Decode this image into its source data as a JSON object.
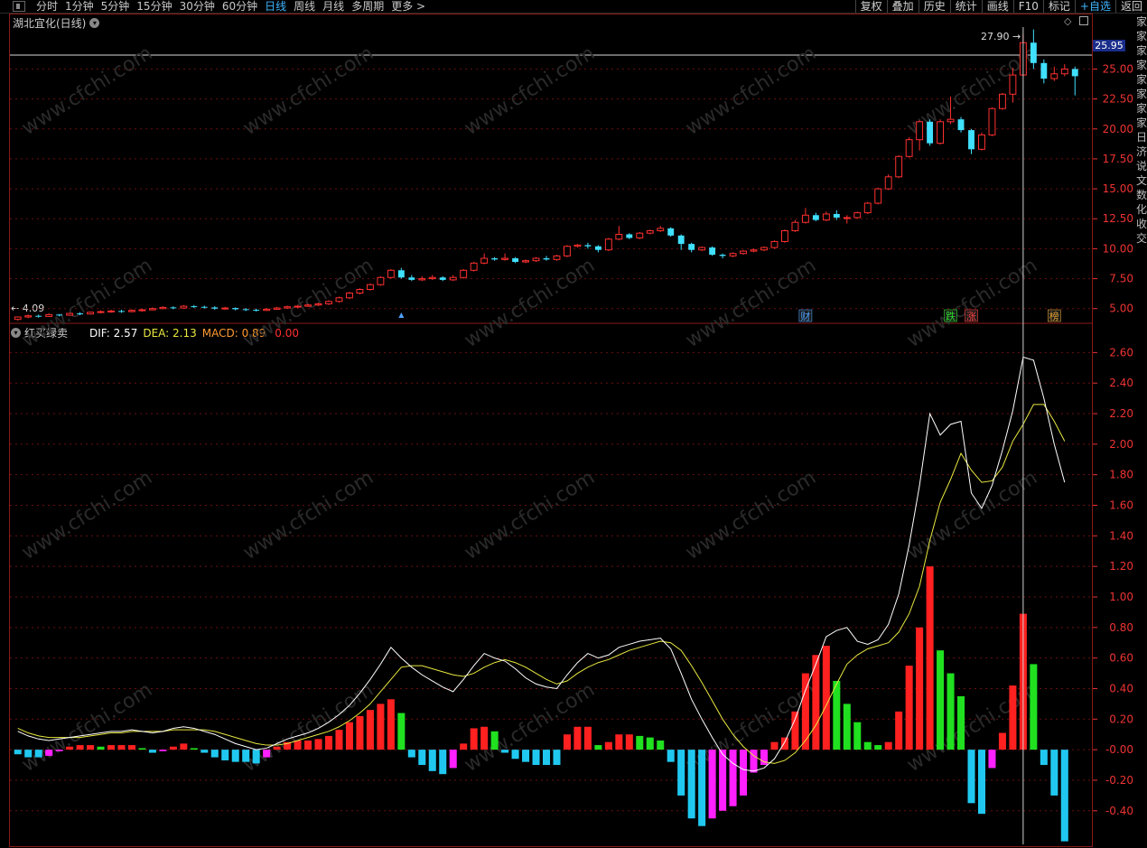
{
  "toolbar": {
    "periods": [
      "分时",
      "1分钟",
      "5分钟",
      "15分钟",
      "30分钟",
      "60分钟",
      "日线",
      "周线",
      "月线",
      "多周期",
      "更多 >"
    ],
    "active_period": "日线",
    "right_buttons": [
      "复权",
      "叠加",
      "历史",
      "统计",
      "画线",
      "F10",
      "标记",
      "+自选",
      "返回"
    ]
  },
  "price_pane": {
    "title": "湖北宜化(日线)",
    "high_label": "27.90",
    "low_label": "4.09",
    "current_price": "25.95",
    "axis_ticks": [
      "25.00",
      "22.50",
      "20.00",
      "17.50",
      "15.00",
      "12.50",
      "10.00",
      "7.50",
      "5.00"
    ],
    "annotations": [
      {
        "text": "财",
        "color": "#4da3ff"
      },
      {
        "text": "跌",
        "color": "#2de02d"
      },
      {
        "text": "涨",
        "color": "#ff4040"
      },
      {
        "text": "榜",
        "color": "#e0a030"
      }
    ]
  },
  "macd_pane": {
    "title": "红买绿卖",
    "dif_label": "DIF: 2.57",
    "dea_label": "DEA: 2.13",
    "macd_label": "MACD: 0.89",
    "extra_label": "0.00",
    "axis_ticks": [
      "2.60",
      "2.40",
      "2.20",
      "2.00",
      "1.80",
      "1.60",
      "1.40",
      "1.20",
      "1.00",
      "0.80",
      "0.60",
      "0.40",
      "0.20",
      "-0.00",
      "-0.20",
      "-0.40"
    ]
  },
  "right_column_chars": [
    "家",
    "家",
    "家",
    "家",
    "家",
    "家",
    "家",
    "家",
    "日",
    "济",
    "说",
    "文",
    "数",
    "化",
    "收",
    "交"
  ],
  "colors": {
    "up": "#ff3030",
    "down": "#40e0ff",
    "dif": "#ffffff",
    "dea": "#e8e840",
    "hist_up": "#ff2020",
    "hist_weak_up": "#20e020",
    "hist_down": "#20c8f0",
    "hist_weak_down": "#ff20ff",
    "grid": "#6a1010"
  },
  "watermark": "www.cfchi.com",
  "chart_data": {
    "type": "candlestick",
    "y_range": [
      4.0,
      28.5
    ],
    "candles": [
      [
        4.1,
        4.3,
        4.0,
        4.35
      ],
      [
        4.3,
        4.4,
        4.2,
        4.5
      ],
      [
        4.4,
        4.35,
        4.25,
        4.5
      ],
      [
        4.35,
        4.5,
        4.3,
        4.6
      ],
      [
        4.5,
        4.45,
        4.35,
        4.55
      ],
      [
        4.45,
        4.6,
        4.4,
        4.65
      ],
      [
        4.6,
        4.55,
        4.45,
        4.7
      ],
      [
        4.55,
        4.7,
        4.5,
        4.75
      ],
      [
        4.7,
        4.75,
        4.6,
        4.85
      ],
      [
        4.75,
        4.8,
        4.65,
        4.9
      ],
      [
        4.8,
        4.75,
        4.65,
        4.9
      ],
      [
        4.75,
        4.85,
        4.7,
        4.95
      ],
      [
        4.85,
        4.9,
        4.75,
        5.0
      ],
      [
        4.9,
        5.0,
        4.85,
        5.1
      ],
      [
        5.0,
        5.1,
        4.95,
        5.2
      ],
      [
        5.1,
        5.05,
        4.95,
        5.2
      ],
      [
        5.05,
        5.2,
        5.0,
        5.3
      ],
      [
        5.2,
        5.15,
        5.05,
        5.3
      ],
      [
        5.15,
        5.1,
        5.0,
        5.25
      ],
      [
        5.1,
        5.0,
        4.9,
        5.2
      ],
      [
        5.0,
        5.05,
        4.9,
        5.15
      ],
      [
        5.05,
        4.95,
        4.85,
        5.1
      ],
      [
        4.95,
        4.9,
        4.8,
        5.05
      ],
      [
        4.9,
        4.85,
        4.75,
        5.0
      ],
      [
        4.85,
        4.95,
        4.8,
        5.05
      ],
      [
        4.95,
        5.05,
        4.9,
        5.15
      ],
      [
        5.05,
        5.15,
        5.0,
        5.25
      ],
      [
        5.15,
        5.2,
        5.05,
        5.3
      ],
      [
        5.2,
        5.3,
        5.15,
        5.4
      ],
      [
        5.3,
        5.4,
        5.2,
        5.5
      ],
      [
        5.4,
        5.6,
        5.3,
        5.7
      ],
      [
        5.6,
        5.9,
        5.5,
        6.0
      ],
      [
        5.9,
        6.3,
        5.8,
        6.4
      ],
      [
        6.3,
        6.6,
        6.2,
        6.7
      ],
      [
        6.6,
        7.0,
        6.5,
        7.1
      ],
      [
        7.0,
        7.6,
        6.9,
        7.7
      ],
      [
        7.6,
        8.2,
        7.5,
        8.3
      ],
      [
        8.2,
        7.6,
        7.5,
        8.4
      ],
      [
        7.6,
        7.4,
        7.3,
        7.8
      ],
      [
        7.4,
        7.5,
        7.3,
        7.7
      ],
      [
        7.5,
        7.6,
        7.4,
        7.8
      ],
      [
        7.6,
        7.4,
        7.3,
        7.7
      ],
      [
        7.4,
        7.6,
        7.3,
        7.8
      ],
      [
        7.6,
        8.2,
        7.5,
        8.3
      ],
      [
        8.2,
        8.8,
        8.1,
        8.9
      ],
      [
        8.8,
        9.2,
        8.7,
        9.6
      ],
      [
        9.2,
        9.1,
        9.0,
        9.3
      ],
      [
        9.1,
        9.2,
        9.0,
        9.6
      ],
      [
        9.2,
        8.9,
        8.8,
        9.3
      ],
      [
        8.9,
        9.0,
        8.8,
        9.1
      ],
      [
        9.0,
        9.2,
        8.9,
        9.3
      ],
      [
        9.2,
        9.1,
        9.0,
        9.4
      ],
      [
        9.1,
        9.4,
        9.0,
        9.5
      ],
      [
        9.4,
        10.2,
        9.3,
        10.3
      ],
      [
        10.2,
        10.3,
        10.1,
        10.4
      ],
      [
        10.3,
        10.2,
        10.0,
        10.5
      ],
      [
        10.2,
        9.9,
        9.7,
        10.3
      ],
      [
        9.9,
        10.8,
        9.8,
        10.9
      ],
      [
        10.8,
        11.2,
        10.7,
        11.9
      ],
      [
        11.2,
        10.9,
        10.8,
        11.3
      ],
      [
        10.9,
        11.3,
        10.8,
        11.4
      ],
      [
        11.3,
        11.5,
        11.2,
        11.6
      ],
      [
        11.5,
        11.7,
        11.4,
        11.9
      ],
      [
        11.7,
        11.1,
        11.0,
        11.8
      ],
      [
        11.1,
        10.4,
        9.9,
        11.2
      ],
      [
        10.4,
        9.9,
        9.7,
        10.5
      ],
      [
        9.9,
        10.1,
        9.8,
        10.2
      ],
      [
        10.1,
        9.5,
        9.4,
        10.2
      ],
      [
        9.5,
        9.4,
        9.2,
        9.6
      ],
      [
        9.4,
        9.6,
        9.3,
        9.7
      ],
      [
        9.6,
        9.8,
        9.5,
        9.9
      ],
      [
        9.8,
        9.9,
        9.7,
        10.0
      ],
      [
        9.9,
        10.1,
        9.8,
        10.2
      ],
      [
        10.1,
        10.6,
        10.0,
        10.7
      ],
      [
        10.6,
        11.5,
        10.5,
        11.6
      ],
      [
        11.5,
        12.2,
        11.4,
        12.4
      ],
      [
        12.2,
        12.8,
        12.1,
        13.4
      ],
      [
        12.8,
        12.4,
        12.3,
        13.0
      ],
      [
        12.4,
        12.9,
        12.3,
        13.1
      ],
      [
        12.9,
        12.6,
        12.4,
        13.2
      ],
      [
        12.6,
        12.6,
        12.1,
        12.8
      ],
      [
        12.6,
        13.0,
        12.5,
        13.1
      ],
      [
        13.0,
        13.8,
        12.9,
        13.9
      ],
      [
        13.8,
        15.0,
        13.7,
        15.1
      ],
      [
        15.0,
        16.0,
        14.9,
        16.2
      ],
      [
        16.0,
        17.7,
        15.9,
        17.8
      ],
      [
        17.7,
        19.1,
        17.6,
        19.3
      ],
      [
        19.1,
        20.6,
        18.2,
        20.7
      ],
      [
        20.6,
        18.8,
        18.6,
        20.8
      ],
      [
        18.8,
        20.6,
        18.7,
        20.8
      ],
      [
        20.6,
        20.8,
        20.4,
        22.7
      ],
      [
        20.8,
        19.9,
        19.7,
        21.0
      ],
      [
        19.9,
        18.3,
        17.9,
        20.0
      ],
      [
        18.3,
        19.5,
        18.2,
        19.7
      ],
      [
        19.5,
        21.7,
        19.4,
        21.8
      ],
      [
        21.7,
        22.9,
        21.6,
        23.0
      ],
      [
        22.9,
        24.5,
        22.2,
        25.1
      ],
      [
        24.5,
        27.2,
        24.4,
        27.9
      ],
      [
        27.2,
        25.5,
        25.0,
        28.3
      ],
      [
        25.5,
        24.2,
        23.8,
        25.8
      ],
      [
        24.2,
        24.6,
        24.0,
        25.2
      ],
      [
        24.6,
        25.0,
        24.4,
        25.4
      ],
      [
        25.0,
        24.4,
        22.8,
        25.2
      ]
    ],
    "macd": {
      "dif": [
        0.12,
        0.09,
        0.07,
        0.06,
        0.07,
        0.08,
        0.09,
        0.1,
        0.11,
        0.12,
        0.12,
        0.13,
        0.12,
        0.11,
        0.12,
        0.14,
        0.15,
        0.14,
        0.12,
        0.1,
        0.07,
        0.04,
        0.02,
        0.0,
        0.01,
        0.04,
        0.07,
        0.09,
        0.11,
        0.14,
        0.18,
        0.23,
        0.29,
        0.37,
        0.46,
        0.56,
        0.67,
        0.6,
        0.54,
        0.49,
        0.45,
        0.41,
        0.38,
        0.46,
        0.55,
        0.63,
        0.6,
        0.58,
        0.53,
        0.47,
        0.43,
        0.41,
        0.4,
        0.49,
        0.57,
        0.63,
        0.6,
        0.62,
        0.67,
        0.69,
        0.71,
        0.72,
        0.73,
        0.66,
        0.5,
        0.33,
        0.2,
        0.08,
        -0.03,
        -0.09,
        -0.13,
        -0.14,
        -0.12,
        -0.06,
        0.05,
        0.2,
        0.39,
        0.56,
        0.74,
        0.78,
        0.8,
        0.71,
        0.69,
        0.72,
        0.82,
        1.02,
        1.34,
        1.73,
        2.2,
        2.06,
        2.13,
        2.15,
        1.68,
        1.58,
        1.73,
        1.96,
        2.22,
        2.57,
        2.55,
        2.3,
        2.0,
        1.75
      ],
      "dea": [
        0.14,
        0.11,
        0.09,
        0.08,
        0.08,
        0.08,
        0.08,
        0.09,
        0.1,
        0.11,
        0.11,
        0.12,
        0.12,
        0.12,
        0.12,
        0.13,
        0.13,
        0.13,
        0.13,
        0.12,
        0.1,
        0.08,
        0.06,
        0.04,
        0.03,
        0.03,
        0.04,
        0.06,
        0.08,
        0.1,
        0.12,
        0.15,
        0.19,
        0.24,
        0.3,
        0.38,
        0.46,
        0.54,
        0.55,
        0.55,
        0.53,
        0.51,
        0.49,
        0.48,
        0.5,
        0.54,
        0.57,
        0.59,
        0.57,
        0.54,
        0.5,
        0.46,
        0.43,
        0.45,
        0.5,
        0.54,
        0.57,
        0.59,
        0.62,
        0.65,
        0.67,
        0.69,
        0.71,
        0.7,
        0.65,
        0.55,
        0.44,
        0.32,
        0.2,
        0.1,
        0.02,
        -0.04,
        -0.08,
        -0.09,
        -0.07,
        -0.02,
        0.06,
        0.16,
        0.29,
        0.43,
        0.56,
        0.62,
        0.66,
        0.68,
        0.7,
        0.77,
        0.89,
        1.07,
        1.37,
        1.62,
        1.77,
        1.94,
        1.83,
        1.75,
        1.76,
        1.85,
        2.02,
        2.13,
        2.26,
        2.26,
        2.15,
        2.02
      ],
      "hist": [
        -0.03,
        -0.05,
        -0.05,
        -0.04,
        -0.01,
        0.02,
        0.03,
        0.03,
        0.02,
        0.03,
        0.03,
        0.03,
        0.01,
        -0.02,
        -0.01,
        0.02,
        0.04,
        0.01,
        -0.02,
        -0.05,
        -0.07,
        -0.08,
        -0.08,
        -0.09,
        -0.05,
        0.02,
        0.05,
        0.06,
        0.06,
        0.07,
        0.09,
        0.13,
        0.18,
        0.22,
        0.26,
        0.3,
        0.33,
        0.24,
        -0.05,
        -0.1,
        -0.14,
        -0.16,
        -0.12,
        0.04,
        0.14,
        0.15,
        0.12,
        -0.02,
        -0.06,
        -0.08,
        -0.1,
        -0.1,
        -0.1,
        0.1,
        0.15,
        0.15,
        0.03,
        0.05,
        0.1,
        0.1,
        0.09,
        0.08,
        0.06,
        -0.08,
        -0.3,
        -0.45,
        -0.5,
        -0.45,
        -0.4,
        -0.37,
        -0.3,
        -0.15,
        -0.1,
        0.05,
        0.08,
        0.25,
        0.5,
        0.62,
        0.68,
        0.45,
        0.3,
        0.18,
        0.05,
        0.03,
        0.05,
        0.25,
        0.55,
        0.8,
        1.2,
        0.65,
        0.5,
        0.35,
        -0.35,
        -0.42,
        -0.12,
        0.11,
        0.42,
        0.89,
        0.56,
        -0.1,
        -0.3,
        -0.6
      ]
    }
  }
}
